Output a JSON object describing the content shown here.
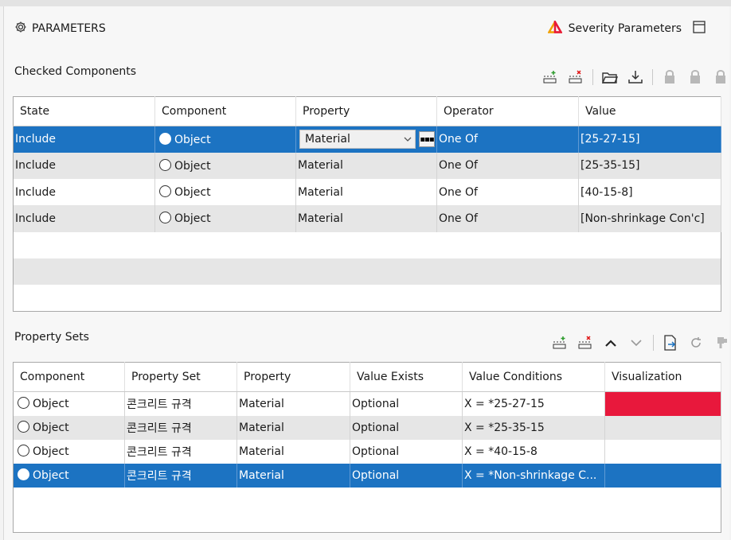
{
  "header": {
    "title": "PARAMETERS",
    "severity_label": "Severity Parameters"
  },
  "checked": {
    "title": "Checked Components",
    "columns": [
      "State",
      "Component",
      "Property",
      "Operator",
      "Value"
    ],
    "rows": [
      {
        "state": "Include",
        "component": "Object",
        "property": "Material",
        "operator": "One Of",
        "value": "[25-27-15]"
      },
      {
        "state": "Include",
        "component": "Object",
        "property": "Material",
        "operator": "One Of",
        "value": "[25-35-15]"
      },
      {
        "state": "Include",
        "component": "Object",
        "property": "Material",
        "operator": "One Of",
        "value": "[40-15-8]"
      },
      {
        "state": "Include",
        "component": "Object",
        "property": "Material",
        "operator": "One Of",
        "value": "[Non-shrinkage Con'c]"
      }
    ]
  },
  "sets": {
    "title": "Property Sets",
    "columns": [
      "Component",
      "Property Set",
      "Property",
      "Value Exists",
      "Value Conditions",
      "Visualization"
    ],
    "rows": [
      {
        "component": "Object",
        "set": "콘크리트 규격",
        "property": "Material",
        "exists": "Optional",
        "conditions": "X = *25-27-15",
        "color": "#e8183c"
      },
      {
        "component": "Object",
        "set": "콘크리트 규격",
        "property": "Material",
        "exists": "Optional",
        "conditions": "X = *25-35-15",
        "color": ""
      },
      {
        "component": "Object",
        "set": "콘크리트 규격",
        "property": "Material",
        "exists": "Optional",
        "conditions": "X = *40-15-8",
        "color": ""
      },
      {
        "component": "Object",
        "set": "콘크리트 규격",
        "property": "Material",
        "exists": "Optional",
        "conditions": "X = *Non-shrinkage C...",
        "color": ""
      }
    ]
  }
}
